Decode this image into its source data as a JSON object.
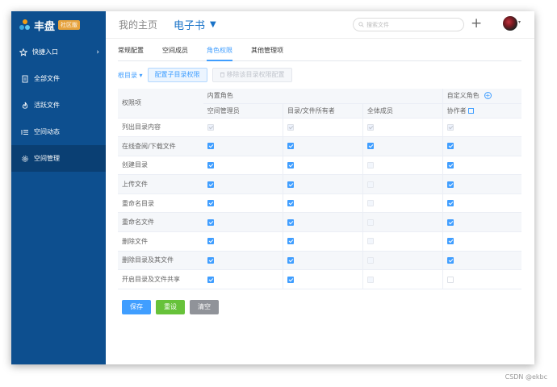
{
  "brand": {
    "name": "丰盘",
    "edition": "社区版"
  },
  "sidebar": {
    "items": [
      {
        "label": "快捷入口",
        "icon": "star-icon",
        "chevron": "›"
      },
      {
        "label": "全部文件",
        "icon": "file-icon"
      },
      {
        "label": "活跃文件",
        "icon": "fire-icon"
      },
      {
        "label": "空间动态",
        "icon": "list-icon"
      },
      {
        "label": "空间管理",
        "icon": "gear-icon"
      }
    ]
  },
  "header": {
    "home": "我的主页",
    "library": "电子书",
    "library_caret": "▼",
    "search_placeholder": "搜索文件",
    "plus": "+",
    "avatar_caret": "▾"
  },
  "tabs": [
    "常规配置",
    "空间成员",
    "角色权限",
    "其他管理项"
  ],
  "active_tab": "角色权限",
  "toolbar": {
    "dir_select": "根目录",
    "dir_caret": "▾",
    "config_button": "配置子目录权限",
    "remove_button": "移除该目录权限配置"
  },
  "table": {
    "perm_header": "权限项",
    "builtin_group": "内置角色",
    "custom_group": "自定义角色",
    "columns": [
      "空间管理员",
      "目录/文件所有者",
      "全体成员",
      "协作者"
    ],
    "rows": [
      {
        "label": "列出目录内容",
        "states": [
          "dis-on",
          "dis-on",
          "dis-on",
          "dis-on"
        ]
      },
      {
        "label": "在线查阅/下载文件",
        "states": [
          "on",
          "on",
          "on",
          "on"
        ]
      },
      {
        "label": "创建目录",
        "states": [
          "on",
          "on",
          "dis-off",
          "on"
        ]
      },
      {
        "label": "上传文件",
        "states": [
          "on",
          "on",
          "dis-off",
          "on"
        ]
      },
      {
        "label": "重命名目录",
        "states": [
          "on",
          "on",
          "dis-off",
          "on"
        ]
      },
      {
        "label": "重命名文件",
        "states": [
          "on",
          "on",
          "dis-off",
          "on"
        ]
      },
      {
        "label": "删除文件",
        "states": [
          "on",
          "on",
          "dis-off",
          "on"
        ]
      },
      {
        "label": "删除目录及其文件",
        "states": [
          "on",
          "on",
          "dis-off",
          "on"
        ]
      },
      {
        "label": "开启目录及文件共享",
        "states": [
          "on",
          "on",
          "dis-off",
          "off"
        ]
      }
    ]
  },
  "actions": {
    "save": "保存",
    "reset": "重设",
    "clear": "清空"
  },
  "watermark": "CSDN @ekbc",
  "colors": {
    "sidebar": "#0d4f8f",
    "accent": "#409eff",
    "save": "#409eff",
    "reset": "#67c23a",
    "clear": "#909399"
  }
}
